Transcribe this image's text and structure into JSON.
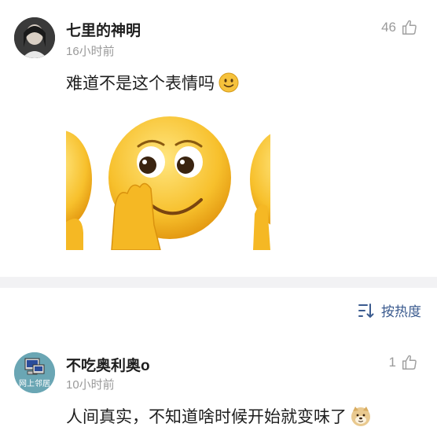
{
  "comments": [
    {
      "username": "七里的神明",
      "time": "16小时前",
      "likes": "46",
      "text": "难道不是这个表情吗",
      "inline_emoji": "slight-smile-icon",
      "sticker": "covering-mouth-smile-sticker"
    },
    {
      "username": "不吃奥利奥o",
      "time": "10小时前",
      "likes": "1",
      "text": "人间真实，不知道啥时候开始就变味了",
      "inline_emoji": "doge-icon",
      "avatar_text": "网上邻居"
    }
  ],
  "sort": {
    "label": "按热度",
    "icon": "sort-icon"
  },
  "colors": {
    "accent": "#3b5b8f",
    "muted": "#9a9a9a",
    "divider": "#f2f2f4"
  }
}
